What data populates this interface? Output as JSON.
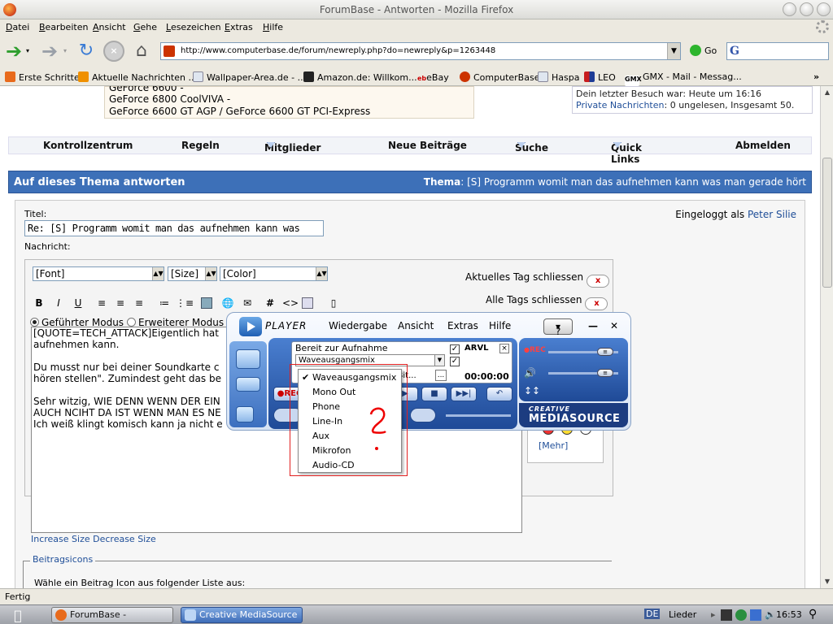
{
  "window": {
    "title": "ForumBase - Antworten - Mozilla Firefox"
  },
  "menubar": [
    "Datei",
    "Bearbeiten",
    "Ansicht",
    "Gehe",
    "Lesezeichen",
    "Extras",
    "Hilfe"
  ],
  "navbar": {
    "url": "http://www.computerbase.de/forum/newreply.php?do=newreply&p=1263448",
    "go_label": "Go"
  },
  "bookmarks": [
    {
      "label": "Erste Schritte",
      "icon": "firefox-icon",
      "color": "#e86a1c"
    },
    {
      "label": "Aktuelle Nachrichten ...",
      "icon": "rss-icon",
      "color": "#f09000"
    },
    {
      "label": "Wallpaper-Area.de - ...",
      "icon": "page-icon",
      "color": "#dfe6f0"
    },
    {
      "label": "Amazon.de: Willkom...",
      "icon": "amazon-icon",
      "color": "#222222"
    },
    {
      "label": "eBay",
      "icon": "ebay-icon",
      "color": "#ffffff"
    },
    {
      "label": "ComputerBase",
      "icon": "computerbase-icon",
      "color": "#cc3300"
    },
    {
      "label": "Haspa",
      "icon": "page-icon",
      "color": "#dfe6f0"
    },
    {
      "label": "LEO",
      "icon": "leo-icon",
      "color": "#c81e1e"
    },
    {
      "label": "GMX - Mail - Messag...",
      "icon": "gmx-icon",
      "color": "#ffffff"
    }
  ],
  "page": {
    "info_lines": [
      "GeForce 6600 -",
      "GeForce 6800 CoolVIVA -",
      "GeForce 6600 GT AGP / GeForce 6600 GT PCI-Express"
    ],
    "user_box": {
      "last_visit": "Dein letzter Besuch war: Heute um 16:16",
      "pm_label": "Private Nachrichten",
      "pm_status": ": 0 ungelesen, Insgesamt 50."
    },
    "nav_items": [
      "Kontrollzentrum",
      "Regeln",
      "Mitglieder",
      "Neue Beiträge",
      "Suche",
      "Quick Links",
      "Abmelden"
    ],
    "reply_header": {
      "title": "Auf dieses Thema antworten",
      "thema_label": "Thema",
      "thema_value": ": [S] Programm womit man das aufnehmen kann was man gerade hört"
    },
    "form": {
      "title_label": "Titel:",
      "title_value": "Re: [S] Programm womit man das aufnehmen kann was",
      "logged_in_prefix": "Eingeloggt als",
      "logged_in_user": "Peter Silie",
      "message_label": "Nachricht:",
      "font_select": "[Font]",
      "size_select": "[Size]",
      "color_select": "[Color]",
      "close_current_tag": "Aktuelles Tag schliessen",
      "close_all_tags": "Alle Tags schliessen",
      "mode_guided": "Geführter Modus",
      "mode_extended": "Erweiterer Modus",
      "toolbar": [
        "B",
        "I",
        "U"
      ],
      "message_lines": [
        "[QUOTE=TECH_ATTACK]Eigentlich hat",
        "aufnehmen kann.",
        "",
        "Du musst nur bei deiner Soundkarte c",
        "hören stellen\". Zumindest geht das be",
        "",
        "Sehr witzig, WIE DENN WENN DER EIN",
        "AUCH NCIHT DA IST WENN MAN ES NE",
        "Ich weiß klingt komisch kann ja nicht e"
      ],
      "size_links": "Increase Size Decrease Size",
      "more_smilies": "[Mehr]",
      "beitragsicons_legend": "Beitragsicons",
      "beitragsicons_text": "Wähle ein Beitrag Icon aus folgender Liste aus:"
    }
  },
  "mediasource": {
    "title": "PLAYER",
    "menu": [
      "Wiedergabe",
      "Ansicht",
      "Extras",
      "Hilfe"
    ],
    "help_button": "?",
    "status": "Bereit zur Aufnahme",
    "source_combo": "Waveausgangsmix",
    "arvl_label": "ARVL",
    "bitrate": "6 Bit...",
    "time": "00:00:00",
    "rec_label": "REC",
    "brand_top": "CREATIVE",
    "brand_main": "MEDIASOURCE",
    "dropdown_items": [
      "Waveausgangsmix",
      "Mono Out",
      "Phone",
      "Line-In",
      "Aux",
      "Mikrofon",
      "Audio-CD"
    ],
    "dropdown_selected": "Waveausgangsmix"
  },
  "annotation": {
    "question_mark": "?"
  },
  "statusbar": {
    "text": "Fertig"
  },
  "taskbar": {
    "tasks": [
      "ForumBase - Antworte...",
      "Creative MediaSource"
    ],
    "tray_lang": "DE",
    "tray_label": "Lieder",
    "clock": "16:53"
  }
}
